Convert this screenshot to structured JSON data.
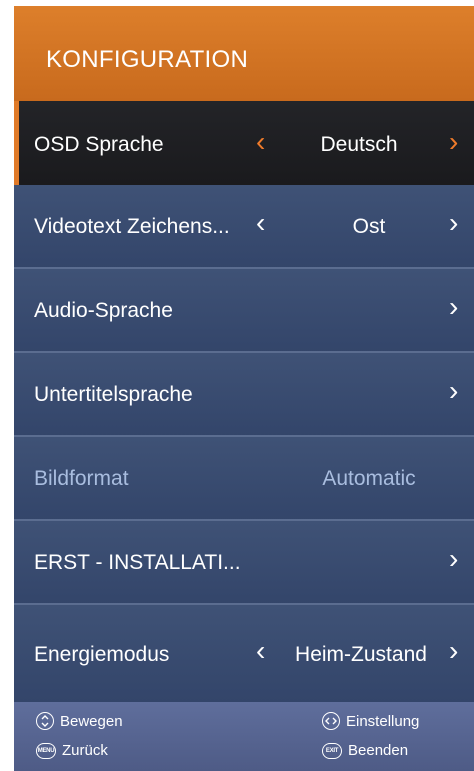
{
  "header": {
    "title": "KONFIGURATION"
  },
  "menu": [
    {
      "label": "OSD Sprache",
      "value": "Deutsch",
      "left_arrow": "‹",
      "right_arrow": "›",
      "state": "selected"
    },
    {
      "label": "Videotext Zeichens...",
      "value": "Ost",
      "left_arrow": "‹",
      "right_arrow": "›",
      "state": "normal"
    },
    {
      "label": "Audio-Sprache",
      "value": "",
      "right_arrow": "›",
      "state": "normal"
    },
    {
      "label": "Untertitelsprache",
      "value": "",
      "right_arrow": "›",
      "state": "normal"
    },
    {
      "label": "Bildformat",
      "value": "Automatic",
      "state": "disabled"
    },
    {
      "label": "ERST - INSTALLATI...",
      "value": "",
      "right_arrow": "›",
      "state": "normal"
    },
    {
      "label": "Energiemodus",
      "value": "Heim-Zustand",
      "left_arrow": "‹",
      "right_arrow": "›",
      "state": "normal"
    }
  ],
  "footer": {
    "move": "Bewegen",
    "setting": "Einstellung",
    "back": "Zurück",
    "exit": "Beenden",
    "menu_badge": "MENU",
    "exit_badge": "EXIT"
  },
  "colors": {
    "accent": "#e07a28",
    "header_bg": "#d3772a",
    "panel_bg": "#354364",
    "footer_bg": "#56648f"
  }
}
